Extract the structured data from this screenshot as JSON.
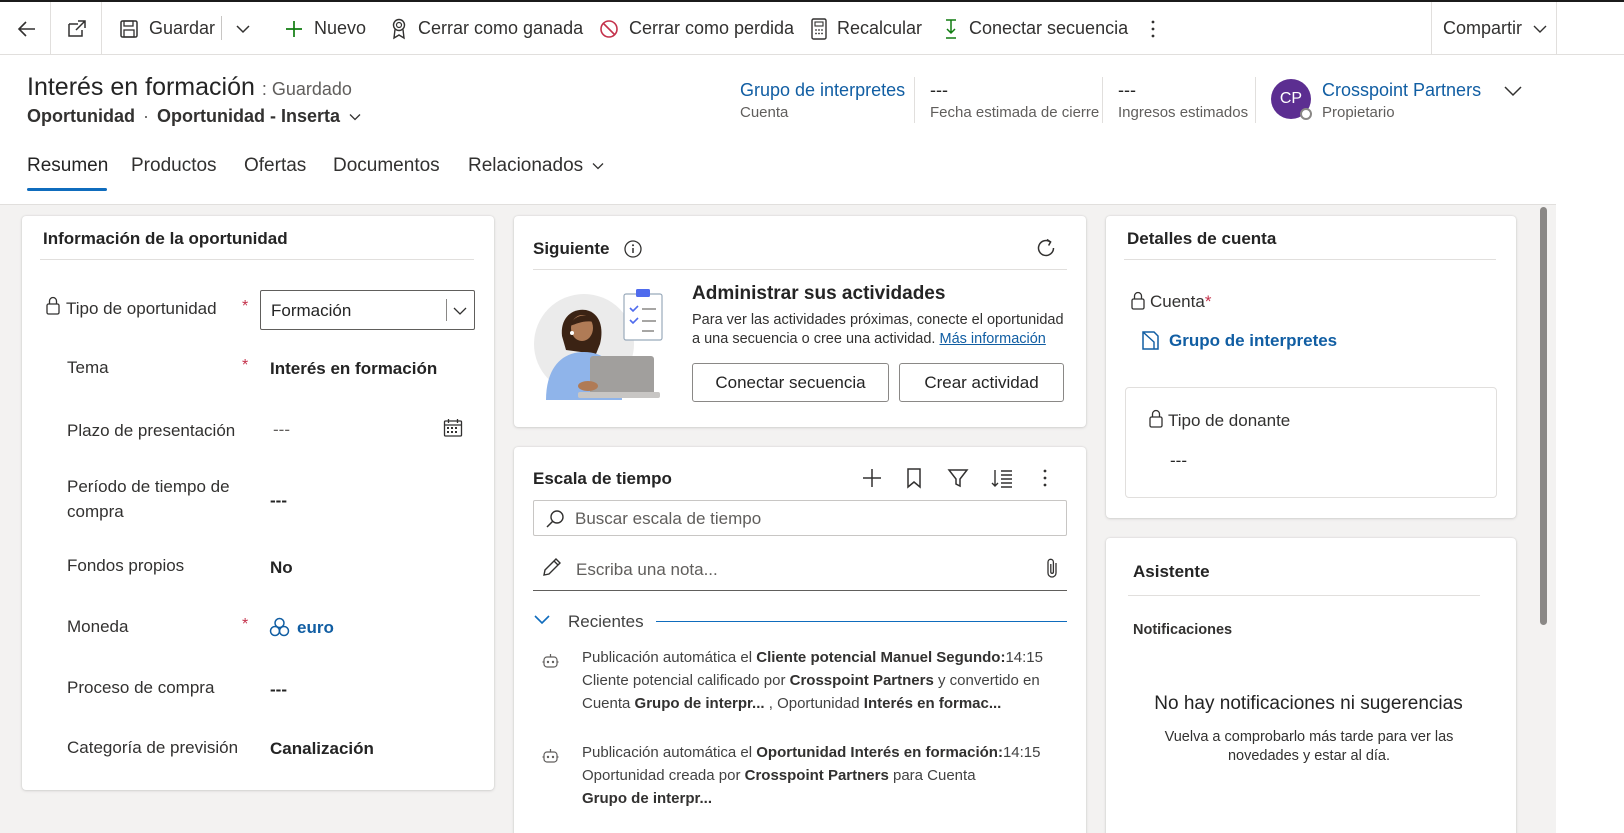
{
  "commandbar": {
    "back_label": "",
    "save_label": "Guardar",
    "new_label": "Nuevo",
    "close_won_label": "Cerrar como ganada",
    "close_lost_label": "Cerrar como perdida",
    "recalc_label": "Recalcular",
    "connect_seq_label": "Conectar secuencia",
    "share_label": "Compartir"
  },
  "header": {
    "title": "Interés en formación",
    "saved": ": Guardado",
    "entity": "Oportunidad",
    "form": "Oportunidad - Inserta",
    "account_value": "Grupo de interpretes",
    "account_label": "Cuenta",
    "close_date_value": "---",
    "close_date_label": "Fecha estimada de cierre",
    "revenue_value": "---",
    "revenue_label": "Ingresos estimados",
    "owner_initials": "CP",
    "owner_name": "Crosspoint Partners",
    "owner_label": "Propietario",
    "avatar_color": "#5c2e91"
  },
  "tabs": [
    "Resumen",
    "Productos",
    "Ofertas",
    "Documentos",
    "Relacionados"
  ],
  "opportunity_info": {
    "title": "Información de la oportunidad",
    "type_label": "Tipo de oportunidad",
    "type_value": "Formación",
    "topic_label": "Tema",
    "topic_value": "Interés en formación",
    "deadline_label": "Plazo de presentación",
    "deadline_value": "---",
    "timeframe_label": "Período de tiempo de compra",
    "timeframe_value": "---",
    "funds_label": "Fondos propios",
    "funds_value": "No",
    "currency_label": "Moneda",
    "currency_value": "euro",
    "process_label": "Proceso de compra",
    "process_value": "---",
    "forecast_label": "Categoría de previsión",
    "forecast_value": "Canalización"
  },
  "next": {
    "title": "Siguiente",
    "heading": "Administrar sus actividades",
    "body": "Para ver las actividades próximas, conecte el oportunidad a una secuencia o cree una actividad.",
    "link": "Más información",
    "connect_button": "Conectar secuencia",
    "create_button": "Crear actividad"
  },
  "timeline": {
    "title": "Escala de tiempo",
    "search_placeholder": "Buscar escala de tiempo",
    "note_placeholder": "Escriba una nota...",
    "recent_label": "Recientes",
    "items": [
      {
        "prefix": "Publicación automática el ",
        "subject": "Cliente potencial Manuel Segundo:",
        "time": "14:15",
        "l2a": "Cliente potencial calificado por ",
        "l2b": "Crosspoint Partners",
        "l2c": " y convertido en",
        "l3a": "Cuenta ",
        "l3b": "Grupo de interpr...",
        "l3c": " , Oportunidad ",
        "l3d": "Interés en formac..."
      },
      {
        "prefix": "Publicación automática el ",
        "subject": "Oportunidad Interés en formación:",
        "time": "14:15",
        "l2a": "Oportunidad creada por ",
        "l2b": "Crosspoint Partners",
        "l2c": " para Cuenta",
        "l3a": "",
        "l3b": "Grupo de interpr...",
        "l3c": "",
        "l3d": ""
      }
    ]
  },
  "account_details": {
    "title": "Detalles de cuenta",
    "account_label": "Cuenta",
    "account_value": "Grupo de interpretes",
    "donor_label": "Tipo de donante",
    "donor_value": "---"
  },
  "assistant": {
    "title": "Asistente",
    "notifications_label": "Notificaciones",
    "empty_title": "No hay notificaciones ni sugerencias",
    "empty_body": "Vuelva a comprobarlo más tarde para ver las novedades y estar al día."
  },
  "colors": {
    "link": "#115ea3",
    "accent": "#0f6cbd",
    "required": "#c4314b"
  }
}
